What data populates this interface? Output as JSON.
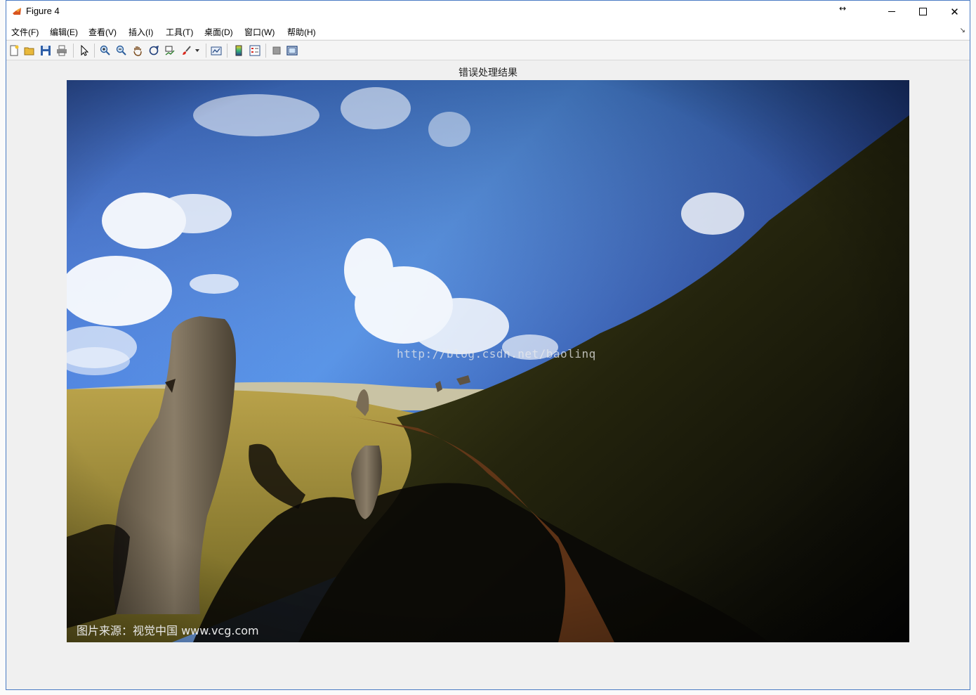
{
  "window": {
    "title": "Figure 4",
    "resize_glyph": "↔",
    "minimize_glyph": "—",
    "maximize_glyph": "☐",
    "close_glyph": "✕"
  },
  "menu": {
    "items": [
      "文件(F)",
      "编辑(E)",
      "查看(V)",
      "插入(I)",
      "工具(T)",
      "桌面(D)",
      "窗口(W)",
      "帮助(H)"
    ],
    "overflow_glyph": "↘"
  },
  "toolbar": {
    "icons": [
      "new-figure-icon",
      "open-file-icon",
      "save-icon",
      "print-icon",
      "pointer-icon",
      "zoom-in-icon",
      "zoom-out-icon",
      "pan-hand-icon",
      "rotate-3d-icon",
      "data-cursor-icon",
      "brush-icon",
      "link-plot-icon",
      "colorbar-icon",
      "legend-icon",
      "hide-plot-tools-icon",
      "show-plot-tools-icon"
    ]
  },
  "axes": {
    "title": "错误处理结果"
  },
  "image": {
    "watermark_url": "http://blog.csdn.net/baolinq",
    "credit_text": "图片来源：视觉中国 www.vcg.com"
  }
}
